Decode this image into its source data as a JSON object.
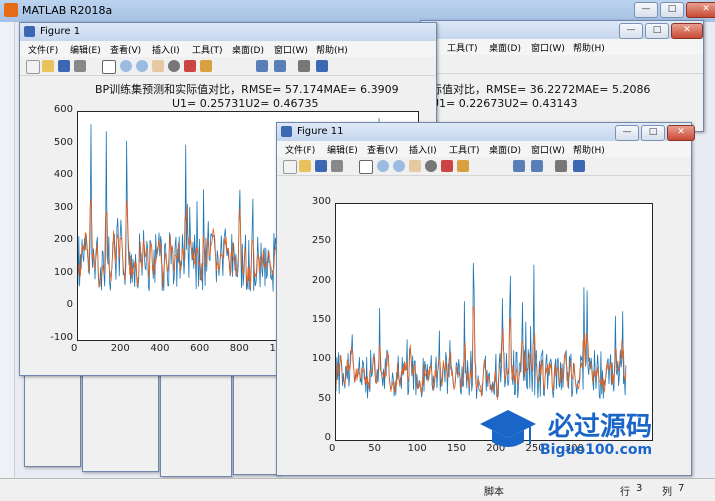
{
  "app": {
    "title": "MATLAB R2018a",
    "status": {
      "script": "脚本",
      "row_label": "行",
      "row": "3",
      "col_label": "列",
      "col": "7"
    }
  },
  "figure_windows": [
    {
      "title": "Figure 1",
      "menu": [
        "文件(F)",
        "编辑(E)",
        "查看(V)",
        "插入(I)",
        "工具(T)",
        "桌面(D)",
        "窗口(W)",
        "帮助(H)"
      ],
      "plot_title_line1": "BP训练集预测和实际值对比，RMSE= 57.174MAE= 6.3909",
      "plot_title_line2": "U1= 0.25731U2= 0.46735",
      "yticks": [
        "600",
        "500",
        "400",
        "300",
        "200",
        "100",
        "0",
        "-100"
      ],
      "xticks": [
        "0",
        "200",
        "400",
        "600",
        "800",
        "10"
      ]
    },
    {
      "title": "Figure 11",
      "menu": [
        "文件(F)",
        "编辑(E)",
        "查看(V)",
        "插入(I)",
        "工具(T)",
        "桌面(D)",
        "窗口(W)",
        "帮助(H)"
      ],
      "yticks": [
        "300",
        "250",
        "200",
        "150",
        "100",
        "50",
        "0"
      ],
      "xticks": [
        "0",
        "50",
        "100",
        "150",
        "200",
        "250",
        "300"
      ]
    }
  ],
  "background_figure": {
    "menu": [
      "工具(T)",
      "桌面(D)",
      "窗口(W)",
      "帮助(H)"
    ],
    "plot_title_line1": "际值对比，RMSE= 36.2272MAE= 5.2086",
    "plot_title_line2": "U1= 0.22673U2= 0.43143"
  },
  "watermark": {
    "text": "必过源码",
    "url": "Biguo100.com"
  },
  "colors": {
    "actual": "#1f77b4",
    "predicted": "#e8601c",
    "accent": "#3b67b3"
  }
}
